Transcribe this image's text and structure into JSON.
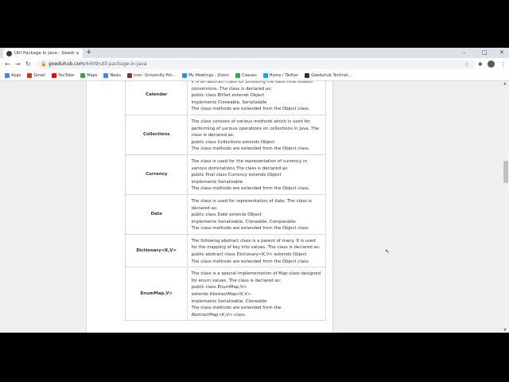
{
  "browser": {
    "tab_title": "Util Package in Java - Goeduhub",
    "url_host": "goeduhub.com",
    "url_path": "/4409/util-package-in-java",
    "bookmarks": [
      {
        "label": "Apps",
        "icon": "apps-grid-icon",
        "color": "#4285f4"
      },
      {
        "label": "Gmail",
        "icon": "gmail-icon",
        "color": "#d93025"
      },
      {
        "label": "YouTube",
        "icon": "youtube-icon",
        "color": "#ff0000"
      },
      {
        "label": "Maps",
        "icon": "maps-pin-icon",
        "color": "#34a853"
      },
      {
        "label": "News",
        "icon": "news-icon",
        "color": "#4285f4"
      },
      {
        "label": "Icon: University Por...",
        "icon": "university-icon",
        "color": "#7a3b2e"
      },
      {
        "label": "My Meetings - Zoom",
        "icon": "zoom-icon",
        "color": "#2d8cff"
      },
      {
        "label": "Classes",
        "icon": "classroom-icon",
        "color": "#34a853"
      },
      {
        "label": "Home / Twitter",
        "icon": "twitter-icon",
        "color": "#1da1f2"
      },
      {
        "label": "Goeduhub Technol...",
        "icon": "goeduhub-icon",
        "color": "#333333"
      }
    ]
  },
  "table": {
    "rows": [
      {
        "name": "Calendar",
        "lines": [
          "It is an abstract class for providing the date time related",
          "conversions. The class is declared as:",
          "public class BitSet extends Object",
          "implements Cloneable, Serializable",
          "The class methods are extended from the Object class."
        ]
      },
      {
        "name": "Collections",
        "lines": [
          "The class consists of various methods which is used for",
          "performing of various operations on collections in Java. The",
          "class is declared as:",
          "public class Collections extends Object",
          "The class methods are extended from the Object class."
        ]
      },
      {
        "name": "Currency",
        "lines": [
          "The class is used for the representation of currency in",
          "various dominations.The class is declared as:",
          "public final class Currency extends Object",
          "implements Serializable",
          "The class methods are extended from the Object class."
        ]
      },
      {
        "name": "Date",
        "lines": [
          "The class is used for representation of date. The class is",
          "declared as:",
          "public class Date extends Object",
          "implements Serializable, Cloneable, Comparable",
          "The class methods are extended from the Object class."
        ]
      },
      {
        "name": "Dictionary<K,V>",
        "lines": [
          "The following abstract class is a parent of many. It is used",
          "for the mapping of key into values. The class is declared as:",
          "public abstract class Dictionary<K,V> extends Object",
          "The class methods are extended from the Object class."
        ]
      },
      {
        "name": "EnumMap,V>",
        "lines": [
          "The class is a special implementation of Map class designed",
          "for enum values. The class is declared as:",
          "public class EnumMap,V>",
          "extends AbstractMap<K,V>",
          "implements Serializable, Cloneable",
          "The class methods are extended from the",
          "AbstractMap<K,V> class."
        ]
      }
    ]
  }
}
